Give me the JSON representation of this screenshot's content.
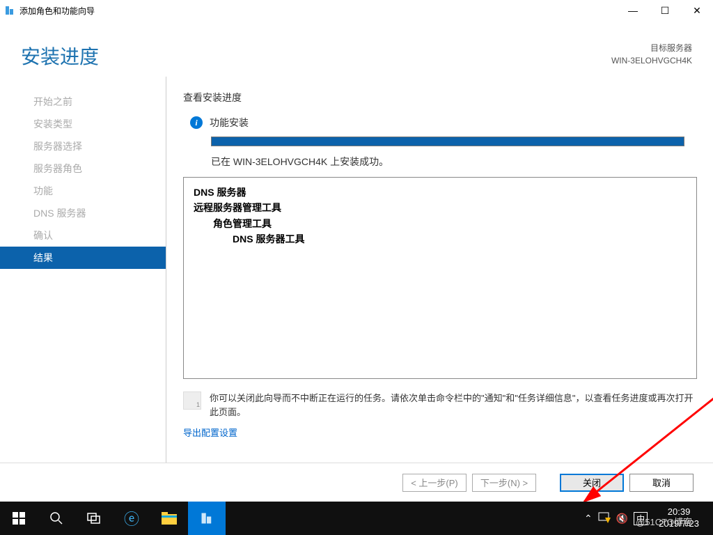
{
  "window": {
    "title": "添加角色和功能向导"
  },
  "header": {
    "page_title": "安装进度",
    "target_label": "目标服务器",
    "target_server": "WIN-3ELOHVGCH4K"
  },
  "sidebar": {
    "items": [
      {
        "label": "开始之前"
      },
      {
        "label": "安装类型"
      },
      {
        "label": "服务器选择"
      },
      {
        "label": "服务器角色"
      },
      {
        "label": "功能"
      },
      {
        "label": "DNS 服务器"
      },
      {
        "label": "确认"
      },
      {
        "label": "结果"
      }
    ],
    "active_index": 7
  },
  "main": {
    "section_label": "查看安装进度",
    "status_text": "功能安装",
    "success_text": "已在 WIN-3ELOHVGCH4K 上安装成功。",
    "results": {
      "line1": "DNS 服务器",
      "line2": "远程服务器管理工具",
      "line3": "角色管理工具",
      "line4": "DNS 服务器工具"
    },
    "note_text": "你可以关闭此向导而不中断正在运行的任务。请依次单击命令栏中的\"通知\"和\"任务详细信息\"，以查看任务进度或再次打开此页面。",
    "export_link": "导出配置设置"
  },
  "footer": {
    "prev": "< 上一步(P)",
    "next": "下一步(N) >",
    "close": "关闭",
    "cancel": "取消"
  },
  "taskbar": {
    "time": "20:39",
    "date": "2019/7/23",
    "ime": "中",
    "watermark": "@51CTO博客"
  }
}
